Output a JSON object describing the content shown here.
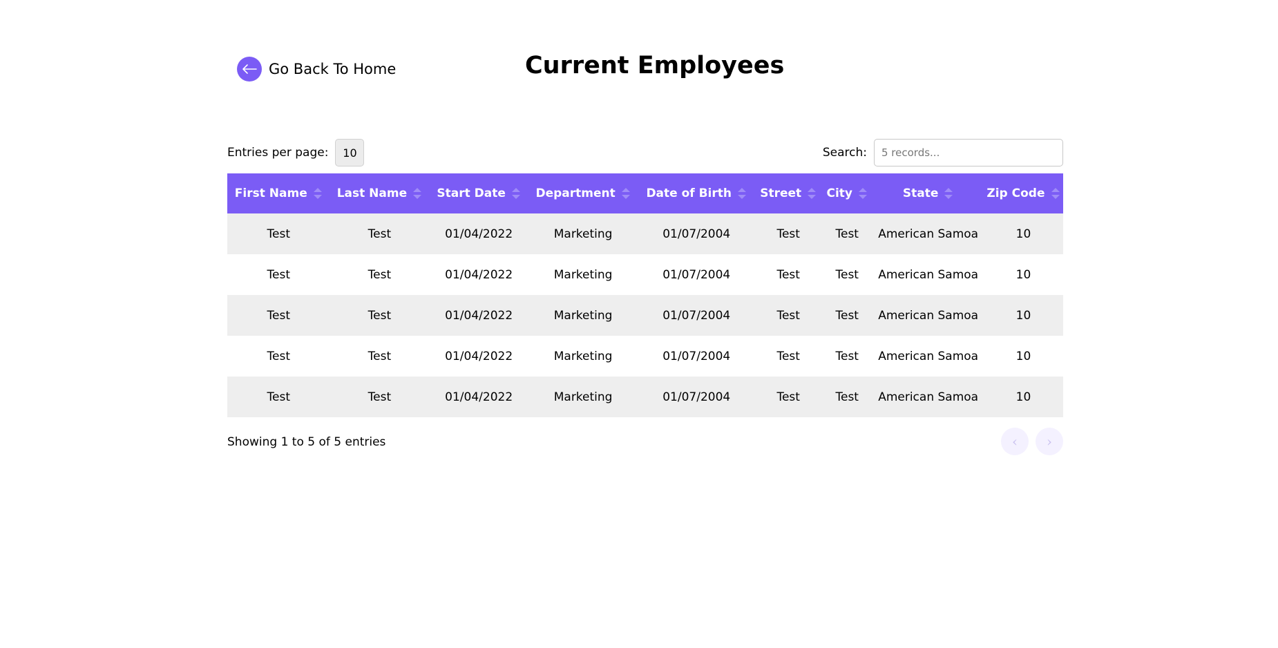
{
  "nav": {
    "back_label": "Go Back To Home",
    "back_icon": "arrow-left-icon"
  },
  "page": {
    "title": "Current Employees"
  },
  "colors": {
    "accent": "#7b5cf5",
    "row_stripe": "#eeeeee"
  },
  "controls": {
    "entries_label": "Entries per page:",
    "entries_value": "10",
    "search_label": "Search:",
    "search_placeholder": "5 records..."
  },
  "table": {
    "columns": [
      "First Name",
      "Last Name",
      "Start Date",
      "Department",
      "Date of Birth",
      "Street",
      "City",
      "State",
      "Zip Code"
    ],
    "rows": [
      [
        "Test",
        "Test",
        "01/04/2022",
        "Marketing",
        "01/07/2004",
        "Test",
        "Test",
        "American Samoa",
        "10"
      ],
      [
        "Test",
        "Test",
        "01/04/2022",
        "Marketing",
        "01/07/2004",
        "Test",
        "Test",
        "American Samoa",
        "10"
      ],
      [
        "Test",
        "Test",
        "01/04/2022",
        "Marketing",
        "01/07/2004",
        "Test",
        "Test",
        "American Samoa",
        "10"
      ],
      [
        "Test",
        "Test",
        "01/04/2022",
        "Marketing",
        "01/07/2004",
        "Test",
        "Test",
        "American Samoa",
        "10"
      ],
      [
        "Test",
        "Test",
        "01/04/2022",
        "Marketing",
        "01/07/2004",
        "Test",
        "Test",
        "American Samoa",
        "10"
      ]
    ]
  },
  "footer": {
    "info": "Showing 1 to 5 of 5 entries",
    "prev_label": "‹",
    "next_label": "›"
  }
}
